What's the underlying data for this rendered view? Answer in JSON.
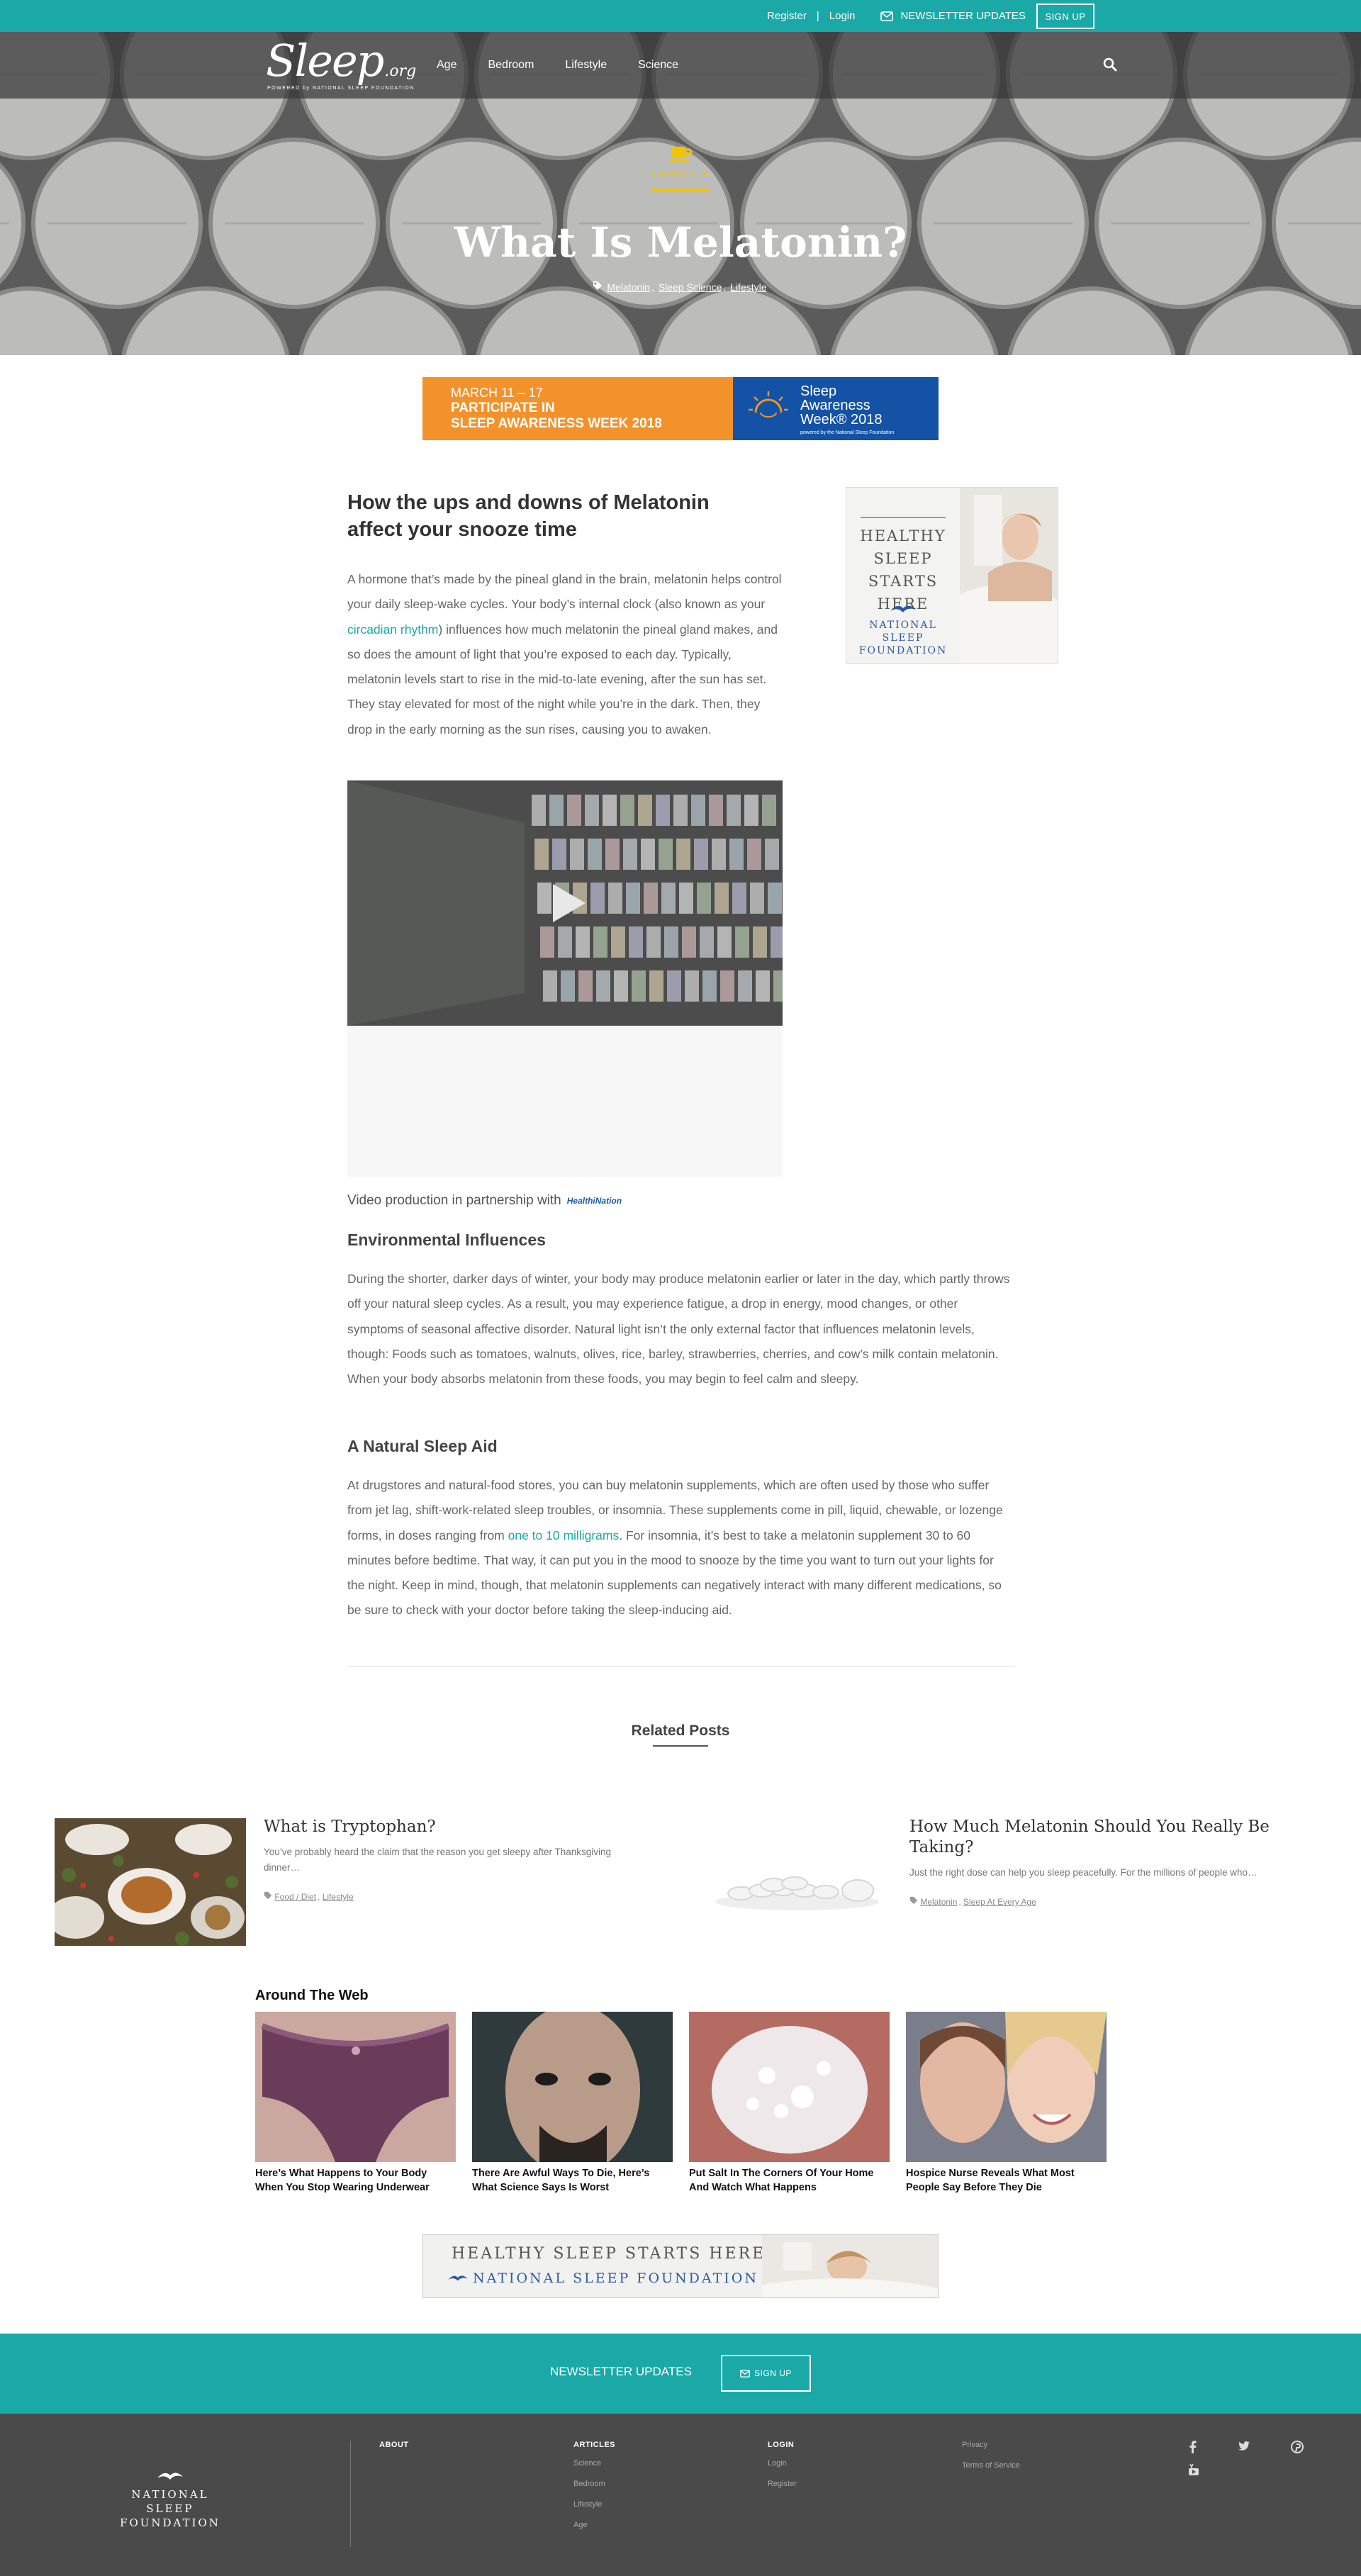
{
  "topbar": {
    "register": "Register",
    "separator": "|",
    "login": "Login",
    "newsletter": "NEWSLETTER UPDATES",
    "signup": "SIGN UP"
  },
  "nav": {
    "logo_word": "Sleep",
    "logo_suffix": ".org",
    "logo_tagline": "POWERED by NATIONAL SLEEP FOUNDATION",
    "items": [
      "Age",
      "Bedroom",
      "Lifestyle",
      "Science"
    ]
  },
  "hero": {
    "category": "LIFESTYLE",
    "title": "What Is Melatonin?",
    "tags": [
      "Melatonin",
      "Sleep Science",
      "Lifestyle"
    ]
  },
  "banner": {
    "dates": "MARCH 11 – 17",
    "line1": "PARTICIPATE IN",
    "line2": "SLEEP AWARENESS WEEK 2018",
    "brand_line1": "Sleep",
    "brand_line2": "Awareness",
    "brand_line3": "Week® 2018",
    "powered": "powered by the National Sleep Foundation"
  },
  "article": {
    "title": "How the ups and downs of Melatonin affect your snooze time",
    "intro_before": "A hormone that’s made by the pineal gland in the brain, melatonin helps control your daily sleep-wake cycles. Your body’s internal clock (also known as your ",
    "intro_link": "circadian rhythm",
    "intro_after": ") influences how much melatonin the pineal gland makes, and so does the amount of light that you’re exposed to each day. Typically, melatonin levels start to rise in the mid-to-late evening, after the sun has set. They stay elevated for most of the night while you’re in the dark. Then, they drop in the early morning as the sun rises, causing you to awaken.",
    "video_credit": "Video production in partnership with",
    "partner": "HealthiNation",
    "h_env": "Environmental Influences",
    "p_env": "During the shorter, darker days of winter, your body may produce melatonin earlier or later in the day, which partly throws off your natural sleep cycles. As a result, you may experience fatigue, a drop in energy, mood changes, or other symptoms of seasonal affective disorder. Natural light isn’t the only external factor that influences melatonin levels, though: Foods such as tomatoes, walnuts, olives, rice, barley, strawberries, cherries, and cow’s milk contain melatonin. When your body absorbs melatonin from these foods, you may begin to feel calm and sleepy.",
    "h_aid": "A Natural Sleep Aid",
    "p_aid_before": "At drugstores and natural-food stores, you can buy melatonin supplements, which are often used by those who suffer from jet lag, shift-work-related sleep troubles, or insomnia. These supplements come in pill, liquid, chewable, or lozenge forms, in doses ranging from ",
    "p_aid_link": "one to 10 milligrams",
    "p_aid_after": ". For insomnia, it’s best to take a melatonin supplement 30 to 60 minutes before bedtime. That way, it can put you in the mood to snooze by the time you want to turn out your lights for the night. Keep in mind, though, that melatonin supplements can negatively interact with many different medications, so be sure to check with your doctor before taking the sleep-inducing aid."
  },
  "side_ad": {
    "line1": "HEALTHY",
    "line2": "SLEEP",
    "line3": "STARTS",
    "line4": "HERE",
    "org1": "NATIONAL SLEEP",
    "org2": "FOUNDATION"
  },
  "related": {
    "title": "Related Posts",
    "posts": [
      {
        "title": "What is Tryptophan?",
        "excerpt": "You’ve probably heard the claim that the reason you get sleepy after Thanksgiving dinner…",
        "tags": [
          "Food / Diet",
          "Lifestyle"
        ]
      },
      {
        "title": "How Much Melatonin Should You Really Be Taking?",
        "excerpt": "Just the right dose can help you sleep peacefully. For the millions of people who…",
        "tags": [
          "Melatonin",
          "Sleep At Every Age"
        ]
      }
    ]
  },
  "around_web": {
    "title": "Around The Web",
    "items": [
      "Here’s What Happens to Your Body When You Stop Wearing Underwear",
      "There Are Awful Ways To Die, Here’s What Science Says Is Worst",
      "Put Salt In The Corners Of Your Home And Watch What Happens",
      "Hospice Nurse Reveals What Most People Say Before They Die"
    ]
  },
  "bottom_ad": {
    "line1": "HEALTHY SLEEP STARTS HERE",
    "line2": "NATIONAL SLEEP FOUNDATION"
  },
  "newsletter": {
    "label": "NEWSLETTER UPDATES",
    "button": "SIGN UP"
  },
  "footer": {
    "logo_line1": "NATIONAL SLEEP",
    "logo_line2": "FOUNDATION",
    "about": "ABOUT",
    "articles_head": "ARTICLES",
    "articles": [
      "Science",
      "Bedroom",
      "Lifestyle",
      "Age"
    ],
    "login_head": "LOGIN",
    "login_items": [
      "Login",
      "Register"
    ],
    "legal": [
      "Privacy",
      "Terms of Service"
    ]
  },
  "colors": {
    "accent": "#1aa9a7",
    "category": "#f2c400",
    "banner_orange": "#f3922a",
    "banner_blue": "#1452a6",
    "footer": "#4a4a4a"
  }
}
